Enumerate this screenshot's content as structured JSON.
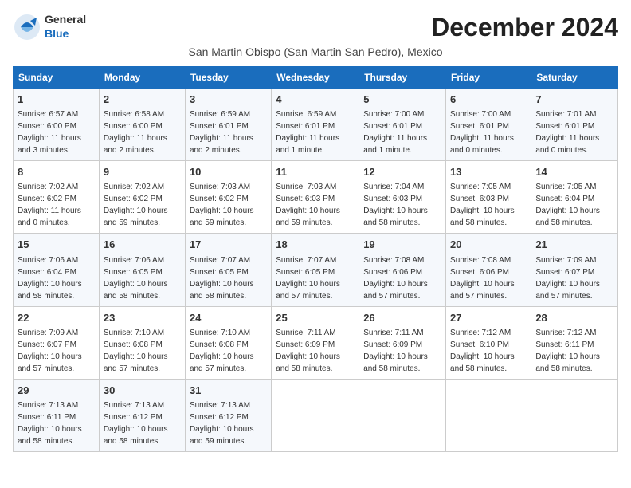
{
  "header": {
    "logo_general": "General",
    "logo_blue": "Blue",
    "title": "December 2024",
    "subtitle": "San Martin Obispo (San Martin San Pedro), Mexico"
  },
  "calendar": {
    "weekdays": [
      "Sunday",
      "Monday",
      "Tuesday",
      "Wednesday",
      "Thursday",
      "Friday",
      "Saturday"
    ],
    "weeks": [
      [
        {
          "day": "1",
          "info": "Sunrise: 6:57 AM\nSunset: 6:00 PM\nDaylight: 11 hours\nand 3 minutes."
        },
        {
          "day": "2",
          "info": "Sunrise: 6:58 AM\nSunset: 6:00 PM\nDaylight: 11 hours\nand 2 minutes."
        },
        {
          "day": "3",
          "info": "Sunrise: 6:59 AM\nSunset: 6:01 PM\nDaylight: 11 hours\nand 2 minutes."
        },
        {
          "day": "4",
          "info": "Sunrise: 6:59 AM\nSunset: 6:01 PM\nDaylight: 11 hours\nand 1 minute."
        },
        {
          "day": "5",
          "info": "Sunrise: 7:00 AM\nSunset: 6:01 PM\nDaylight: 11 hours\nand 1 minute."
        },
        {
          "day": "6",
          "info": "Sunrise: 7:00 AM\nSunset: 6:01 PM\nDaylight: 11 hours\nand 0 minutes."
        },
        {
          "day": "7",
          "info": "Sunrise: 7:01 AM\nSunset: 6:01 PM\nDaylight: 11 hours\nand 0 minutes."
        }
      ],
      [
        {
          "day": "8",
          "info": "Sunrise: 7:02 AM\nSunset: 6:02 PM\nDaylight: 11 hours\nand 0 minutes."
        },
        {
          "day": "9",
          "info": "Sunrise: 7:02 AM\nSunset: 6:02 PM\nDaylight: 10 hours\nand 59 minutes."
        },
        {
          "day": "10",
          "info": "Sunrise: 7:03 AM\nSunset: 6:02 PM\nDaylight: 10 hours\nand 59 minutes."
        },
        {
          "day": "11",
          "info": "Sunrise: 7:03 AM\nSunset: 6:03 PM\nDaylight: 10 hours\nand 59 minutes."
        },
        {
          "day": "12",
          "info": "Sunrise: 7:04 AM\nSunset: 6:03 PM\nDaylight: 10 hours\nand 58 minutes."
        },
        {
          "day": "13",
          "info": "Sunrise: 7:05 AM\nSunset: 6:03 PM\nDaylight: 10 hours\nand 58 minutes."
        },
        {
          "day": "14",
          "info": "Sunrise: 7:05 AM\nSunset: 6:04 PM\nDaylight: 10 hours\nand 58 minutes."
        }
      ],
      [
        {
          "day": "15",
          "info": "Sunrise: 7:06 AM\nSunset: 6:04 PM\nDaylight: 10 hours\nand 58 minutes."
        },
        {
          "day": "16",
          "info": "Sunrise: 7:06 AM\nSunset: 6:05 PM\nDaylight: 10 hours\nand 58 minutes."
        },
        {
          "day": "17",
          "info": "Sunrise: 7:07 AM\nSunset: 6:05 PM\nDaylight: 10 hours\nand 58 minutes."
        },
        {
          "day": "18",
          "info": "Sunrise: 7:07 AM\nSunset: 6:05 PM\nDaylight: 10 hours\nand 57 minutes."
        },
        {
          "day": "19",
          "info": "Sunrise: 7:08 AM\nSunset: 6:06 PM\nDaylight: 10 hours\nand 57 minutes."
        },
        {
          "day": "20",
          "info": "Sunrise: 7:08 AM\nSunset: 6:06 PM\nDaylight: 10 hours\nand 57 minutes."
        },
        {
          "day": "21",
          "info": "Sunrise: 7:09 AM\nSunset: 6:07 PM\nDaylight: 10 hours\nand 57 minutes."
        }
      ],
      [
        {
          "day": "22",
          "info": "Sunrise: 7:09 AM\nSunset: 6:07 PM\nDaylight: 10 hours\nand 57 minutes."
        },
        {
          "day": "23",
          "info": "Sunrise: 7:10 AM\nSunset: 6:08 PM\nDaylight: 10 hours\nand 57 minutes."
        },
        {
          "day": "24",
          "info": "Sunrise: 7:10 AM\nSunset: 6:08 PM\nDaylight: 10 hours\nand 57 minutes."
        },
        {
          "day": "25",
          "info": "Sunrise: 7:11 AM\nSunset: 6:09 PM\nDaylight: 10 hours\nand 58 minutes."
        },
        {
          "day": "26",
          "info": "Sunrise: 7:11 AM\nSunset: 6:09 PM\nDaylight: 10 hours\nand 58 minutes."
        },
        {
          "day": "27",
          "info": "Sunrise: 7:12 AM\nSunset: 6:10 PM\nDaylight: 10 hours\nand 58 minutes."
        },
        {
          "day": "28",
          "info": "Sunrise: 7:12 AM\nSunset: 6:11 PM\nDaylight: 10 hours\nand 58 minutes."
        }
      ],
      [
        {
          "day": "29",
          "info": "Sunrise: 7:13 AM\nSunset: 6:11 PM\nDaylight: 10 hours\nand 58 minutes."
        },
        {
          "day": "30",
          "info": "Sunrise: 7:13 AM\nSunset: 6:12 PM\nDaylight: 10 hours\nand 58 minutes."
        },
        {
          "day": "31",
          "info": "Sunrise: 7:13 AM\nSunset: 6:12 PM\nDaylight: 10 hours\nand 59 minutes."
        },
        null,
        null,
        null,
        null
      ]
    ]
  }
}
